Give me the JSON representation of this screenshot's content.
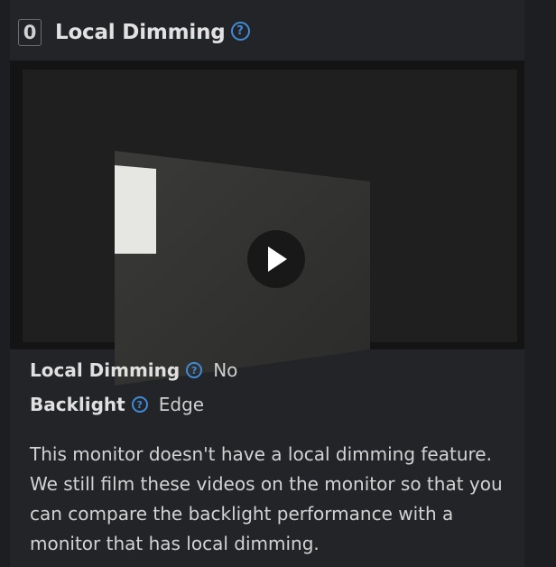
{
  "section": {
    "score": "0",
    "title": "Local Dimming",
    "help_glyph": "?"
  },
  "video": {
    "play_icon": "play-icon"
  },
  "specs": [
    {
      "label": "Local Dimming",
      "value": "No"
    },
    {
      "label": "Backlight",
      "value": "Edge"
    }
  ],
  "description": "This monitor doesn't have a local dimming feature. We still film these videos on the monitor so that you can compare the backlight performance with a monitor that has local dimming.",
  "colors": {
    "background": "#1c1e22",
    "panel": "#222428",
    "accent_help": "#3f8bd8",
    "text": "#d6d6d6"
  }
}
